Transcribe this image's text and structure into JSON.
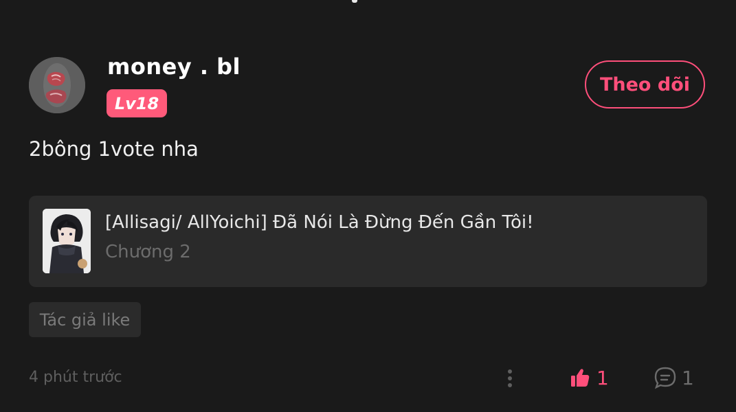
{
  "user": {
    "name": "money . bl",
    "level": "Lv18",
    "follow_label": "Theo dõi"
  },
  "comment": {
    "text": "2bông 1vote nha"
  },
  "story": {
    "title": "[Allisagi/ AllYoichi] Đã Nói Là Đừng Đến Gần Tôi!",
    "chapter": "Chương 2"
  },
  "tag": {
    "label": "Tác giả like"
  },
  "footer": {
    "timestamp": "4 phút trước",
    "like_count": "1",
    "comment_count": "1"
  },
  "icons": {
    "more": "more-vertical-icon",
    "like": "thumbs-up-icon",
    "comment": "comment-bubble-icon"
  },
  "colors": {
    "background": "#1a1a1a",
    "accent": "#ff4f7b",
    "badge": "#ff5a7a",
    "card": "#2a2a2a",
    "muted": "#6c6c6c"
  }
}
